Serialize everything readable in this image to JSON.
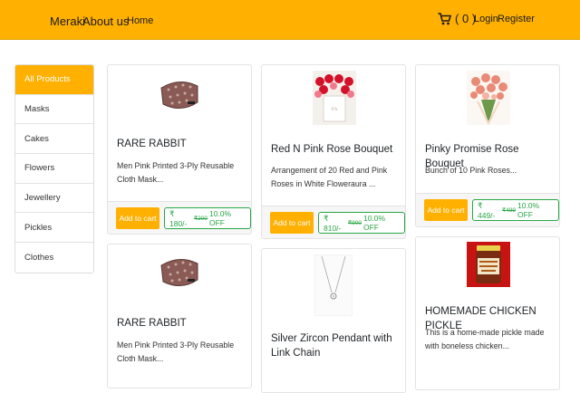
{
  "nav": {
    "brand": "Meraki",
    "about": "About us",
    "home": "Home",
    "cart_count": "( 0 )",
    "login": "Login",
    "register": "Register"
  },
  "categories": [
    "All Products",
    "Masks",
    "Cakes",
    "Flowers",
    "Jewellery",
    "Pickles",
    "Clothes"
  ],
  "products": [
    {
      "title": "RARE RABBIT",
      "desc": "Men Pink Printed 3-Ply Reusable Cloth Mask...",
      "button": "Add to cart",
      "price": "₹ 180/-",
      "mrp": "₹200",
      "discount": "10.0% OFF"
    },
    {
      "title": "Red N Pink Rose Bouquet",
      "desc": "Arrangement of 20 Red and Pink Roses in White Floweraura ...",
      "button": "Add to cart",
      "price": "₹ 810/-",
      "mrp": "₹900",
      "discount": "10.0% OFF"
    },
    {
      "title": "Pinky Promise Rose Bouquet",
      "desc": "Bunch of 10 Pink Roses...",
      "button": "Add to cart",
      "price": "₹ 449/-",
      "mrp": "₹499",
      "discount": "10.0% OFF"
    },
    {
      "title": "RARE RABBIT",
      "desc": "Men Pink Printed 3-Ply Reusable Cloth Mask..."
    },
    {
      "title": "Silver Zircon Pendant with Link Chain",
      "desc": ""
    },
    {
      "title": "HOMEMADE CHICKEN PICKLE",
      "desc": "This is a home-made pickle made with boneless chicken..."
    }
  ],
  "colors": {
    "accent": "#ffb000",
    "price_green": "#28a745"
  }
}
